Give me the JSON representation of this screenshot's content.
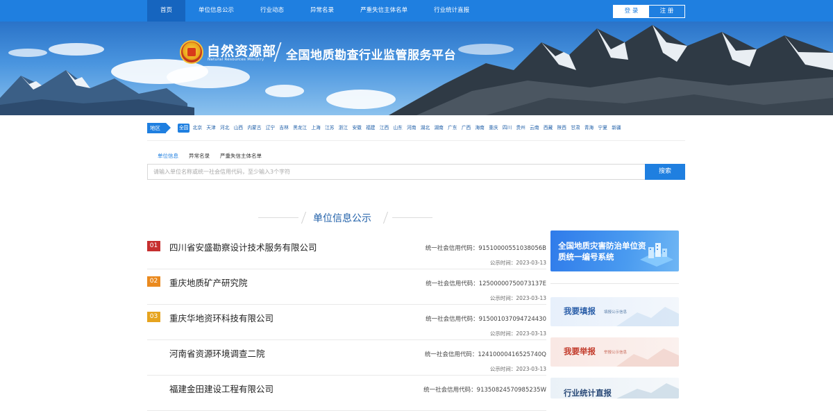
{
  "nav": {
    "items": [
      "首页",
      "单位信息公示",
      "行业动态",
      "异常名录",
      "严重失信主体名单",
      "行业统计直报"
    ],
    "active_index": 0,
    "login": "登 录",
    "register": "注 册"
  },
  "banner": {
    "ministry": "自然资源部",
    "ministry_en": "Natural Resources Ministry",
    "platform_title": "全国地质勘查行业监管服务平台"
  },
  "regions": {
    "label": "地区",
    "items": [
      "全国",
      "北京",
      "天津",
      "河北",
      "山西",
      "内蒙古",
      "辽宁",
      "吉林",
      "黑龙江",
      "上海",
      "江苏",
      "浙江",
      "安徽",
      "福建",
      "江西",
      "山东",
      "河南",
      "湖北",
      "湖南",
      "广东",
      "广西",
      "海南",
      "重庆",
      "四川",
      "贵州",
      "云南",
      "西藏",
      "陕西",
      "甘肃",
      "青海",
      "宁夏",
      "新疆"
    ],
    "active_index": 0
  },
  "search": {
    "tabs": [
      "单位信息",
      "异常名录",
      "严重失信主体名单"
    ],
    "active_tab": 0,
    "placeholder": "请输入单位名称或统一社会信用代码，至少输入3个字符",
    "button": "搜索"
  },
  "section": {
    "title": "单位信息公示"
  },
  "list": [
    {
      "rank": "01",
      "rank_color": "#c62f2f",
      "name": "四川省安盛勘察设计技术服务有限公司",
      "credit": "统一社会信用代码：915100005510380​56B",
      "time": "公示时间：2023-03-13"
    },
    {
      "rank": "02",
      "rank_color": "#ea8a1f",
      "name": "重庆地质矿产研究院",
      "credit": "统一社会信用代码：12500000750073137E",
      "time": "公示时间：2023-03-13"
    },
    {
      "rank": "03",
      "rank_color": "#e6a41f",
      "name": "重庆华地资环科技有限公司",
      "credit": "统一社会信用代码：915001037094724430",
      "time": "公示时间：2023-03-13"
    },
    {
      "rank": "",
      "rank_color": "",
      "name": "河南省资源环境调查二院",
      "credit": "统一社会信用代码：12410000416525740Q",
      "time": "公示时间：2023-03-13"
    },
    {
      "rank": "",
      "rank_color": "",
      "name": "福建金田建设工程有限公司",
      "credit": "统一社会信用代码：91350824570985235W",
      "time": ""
    }
  ],
  "sidebar": {
    "card1_text": "全国地质灾害防治单位资质统一编号系统",
    "card2_title": "我要填报",
    "card2_sub": "填报公示信息",
    "card3_title": "我要举报",
    "card3_sub": "举报公示信息",
    "card4_title": "行业统计直报"
  },
  "colors": {
    "primary": "#1f7fe0",
    "nav_active": "#1665bf",
    "rank1": "#c62f2f",
    "rank2": "#ea8a1f",
    "rank3": "#e6a41f"
  }
}
